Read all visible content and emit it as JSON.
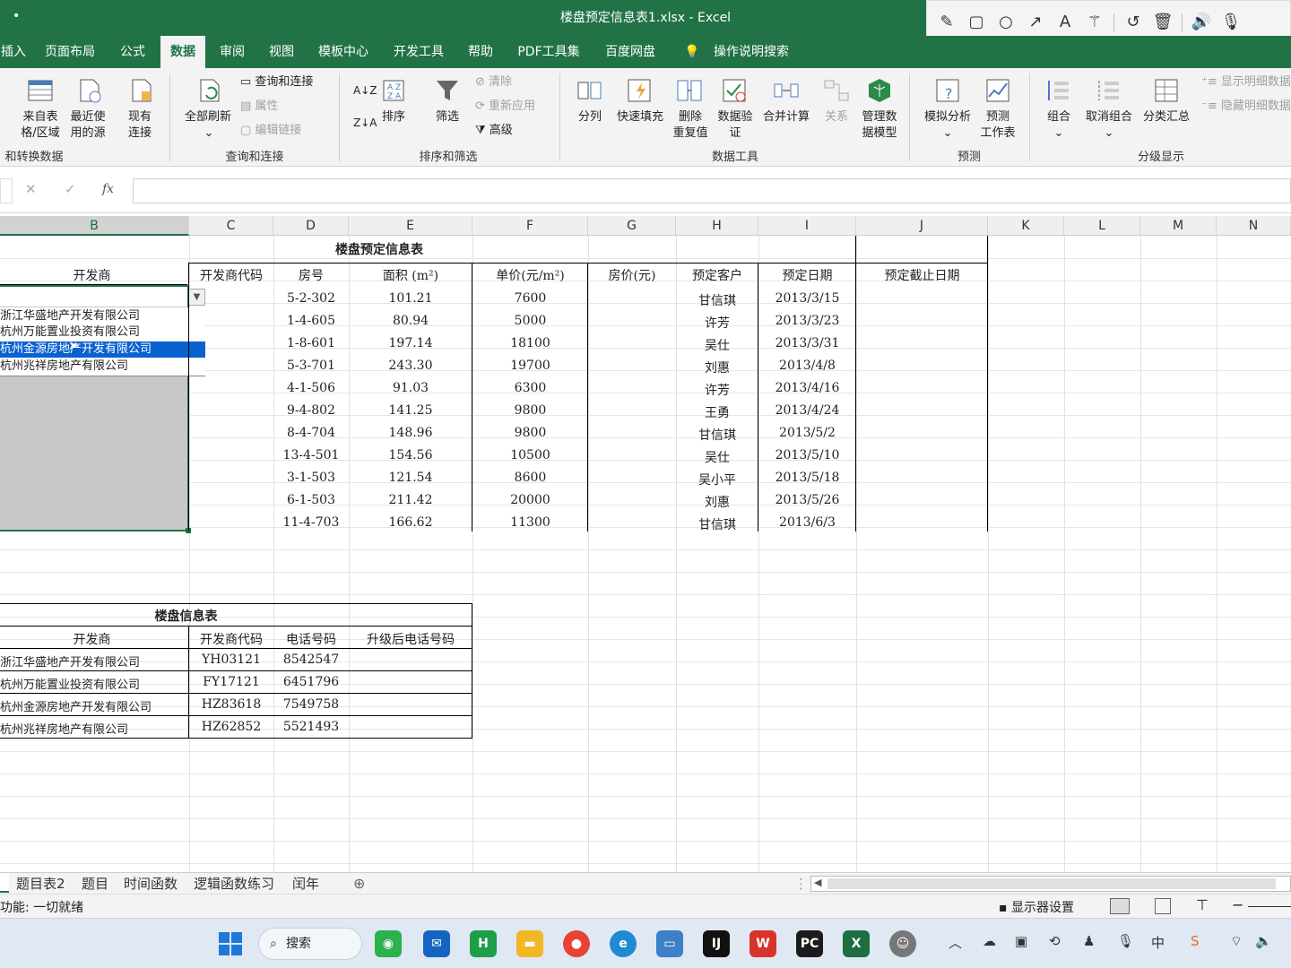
{
  "window": {
    "title": "楼盘预定信息表1.xlsx  -  Excel"
  },
  "tabs": [
    "插入",
    "页面布局",
    "公式",
    "数据",
    "审阅",
    "视图",
    "模板中心",
    "开发工具",
    "帮助",
    "PDF工具集",
    "百度网盘",
    "操作说明搜索"
  ],
  "active_tab": "数据",
  "ribbon": {
    "get_data": {
      "btn1": "来自表\n格/区域",
      "btn2": "最近使\n用的源",
      "btn3": "现有\n连接",
      "group": "和转换数据"
    },
    "queries": {
      "refresh_all": "全部刷新",
      "queries_connections": "查询和连接",
      "properties": "属性",
      "edit_links": "编辑链接",
      "group": "查询和连接"
    },
    "sort_filter": {
      "sort": "排序",
      "filter": "筛选",
      "clear": "清除",
      "reapply": "重新应用",
      "advanced": "高级",
      "group": "排序和筛选"
    },
    "data_tools": {
      "text_to_columns": "分列",
      "flash_fill": "快速填充",
      "remove_duplicates": "删除\n重复值",
      "data_validation": "数据验\n证",
      "consolidate": "合并计算",
      "relationships": "关系",
      "data_model": "管理数\n据模型",
      "group": "数据工具"
    },
    "forecast": {
      "what_if": "模拟分析",
      "forecast_sheet": "预测\n工作表",
      "group": "预测"
    },
    "outline": {
      "group_btn": "组合",
      "ungroup": "取消组合",
      "subtotal": "分类汇总",
      "show_detail": "显示明细数据",
      "hide_detail": "隐藏明细数据",
      "group": "分级显示"
    }
  },
  "formula_bar": {
    "cancel": "✕",
    "enter": "✓",
    "fx": "fx",
    "value": ""
  },
  "columns": [
    "B",
    "C",
    "D",
    "E",
    "F",
    "G",
    "H",
    "I",
    "J",
    "K",
    "L",
    "M",
    "N"
  ],
  "table1": {
    "title": "楼盘预定信息表",
    "headers": [
      "开发商",
      "开发商代码",
      "房号",
      "面积 (m²)",
      "单价(元/m²)",
      "房价(元)",
      "预定客户",
      "预定日期",
      "预定截止日期"
    ],
    "rows": [
      [
        "5-2-302",
        "101.21",
        "7600",
        "甘信琪",
        "2013/3/15"
      ],
      [
        "1-4-605",
        "80.94",
        "5000",
        "许芳",
        "2013/3/23"
      ],
      [
        "1-8-601",
        "197.14",
        "18100",
        "吴仕",
        "2013/3/31"
      ],
      [
        "5-3-701",
        "243.30",
        "19700",
        "刘惠",
        "2013/4/8"
      ],
      [
        "4-1-506",
        "91.03",
        "6300",
        "许芳",
        "2013/4/16"
      ],
      [
        "9-4-802",
        "141.25",
        "9800",
        "王勇",
        "2013/4/24"
      ],
      [
        "8-4-704",
        "148.96",
        "9800",
        "甘信琪",
        "2013/5/2"
      ],
      [
        "13-4-501",
        "154.56",
        "10500",
        "吴仕",
        "2013/5/10"
      ],
      [
        "3-1-503",
        "121.54",
        "8600",
        "吴小平",
        "2013/5/18"
      ],
      [
        "6-1-503",
        "211.42",
        "20000",
        "刘惠",
        "2013/5/26"
      ],
      [
        "11-4-703",
        "166.62",
        "11300",
        "甘信琪",
        "2013/6/3"
      ]
    ]
  },
  "dropdown": {
    "options": [
      "浙江华盛地产开发有限公司",
      "杭州万能置业投资有限公司",
      "杭州金源房地产开发有限公司",
      "杭州兆祥房地产有限公司"
    ],
    "selected_index": 2
  },
  "table2": {
    "title": "楼盘信息表",
    "headers": [
      "开发商",
      "开发商代码",
      "电话号码",
      "升级后电话号码"
    ],
    "rows": [
      [
        "浙江华盛地产开发有限公司",
        "YH03121",
        "8542547",
        ""
      ],
      [
        "杭州万能置业投资有限公司",
        "FY17121",
        "6451796",
        ""
      ],
      [
        "杭州金源房地产开发有限公司",
        "HZ83618",
        "7549758",
        ""
      ],
      [
        "杭州兆祥房地产有限公司",
        "HZ62852",
        "5521493",
        ""
      ]
    ]
  },
  "sheet_tabs": [
    "题目表2",
    "题目",
    "时间函数",
    "逻辑函数练习",
    "闰年"
  ],
  "status": {
    "mode": "功能: 一切就绪",
    "display_settings": "显示器设置"
  },
  "taskbar": {
    "search": "搜索"
  }
}
